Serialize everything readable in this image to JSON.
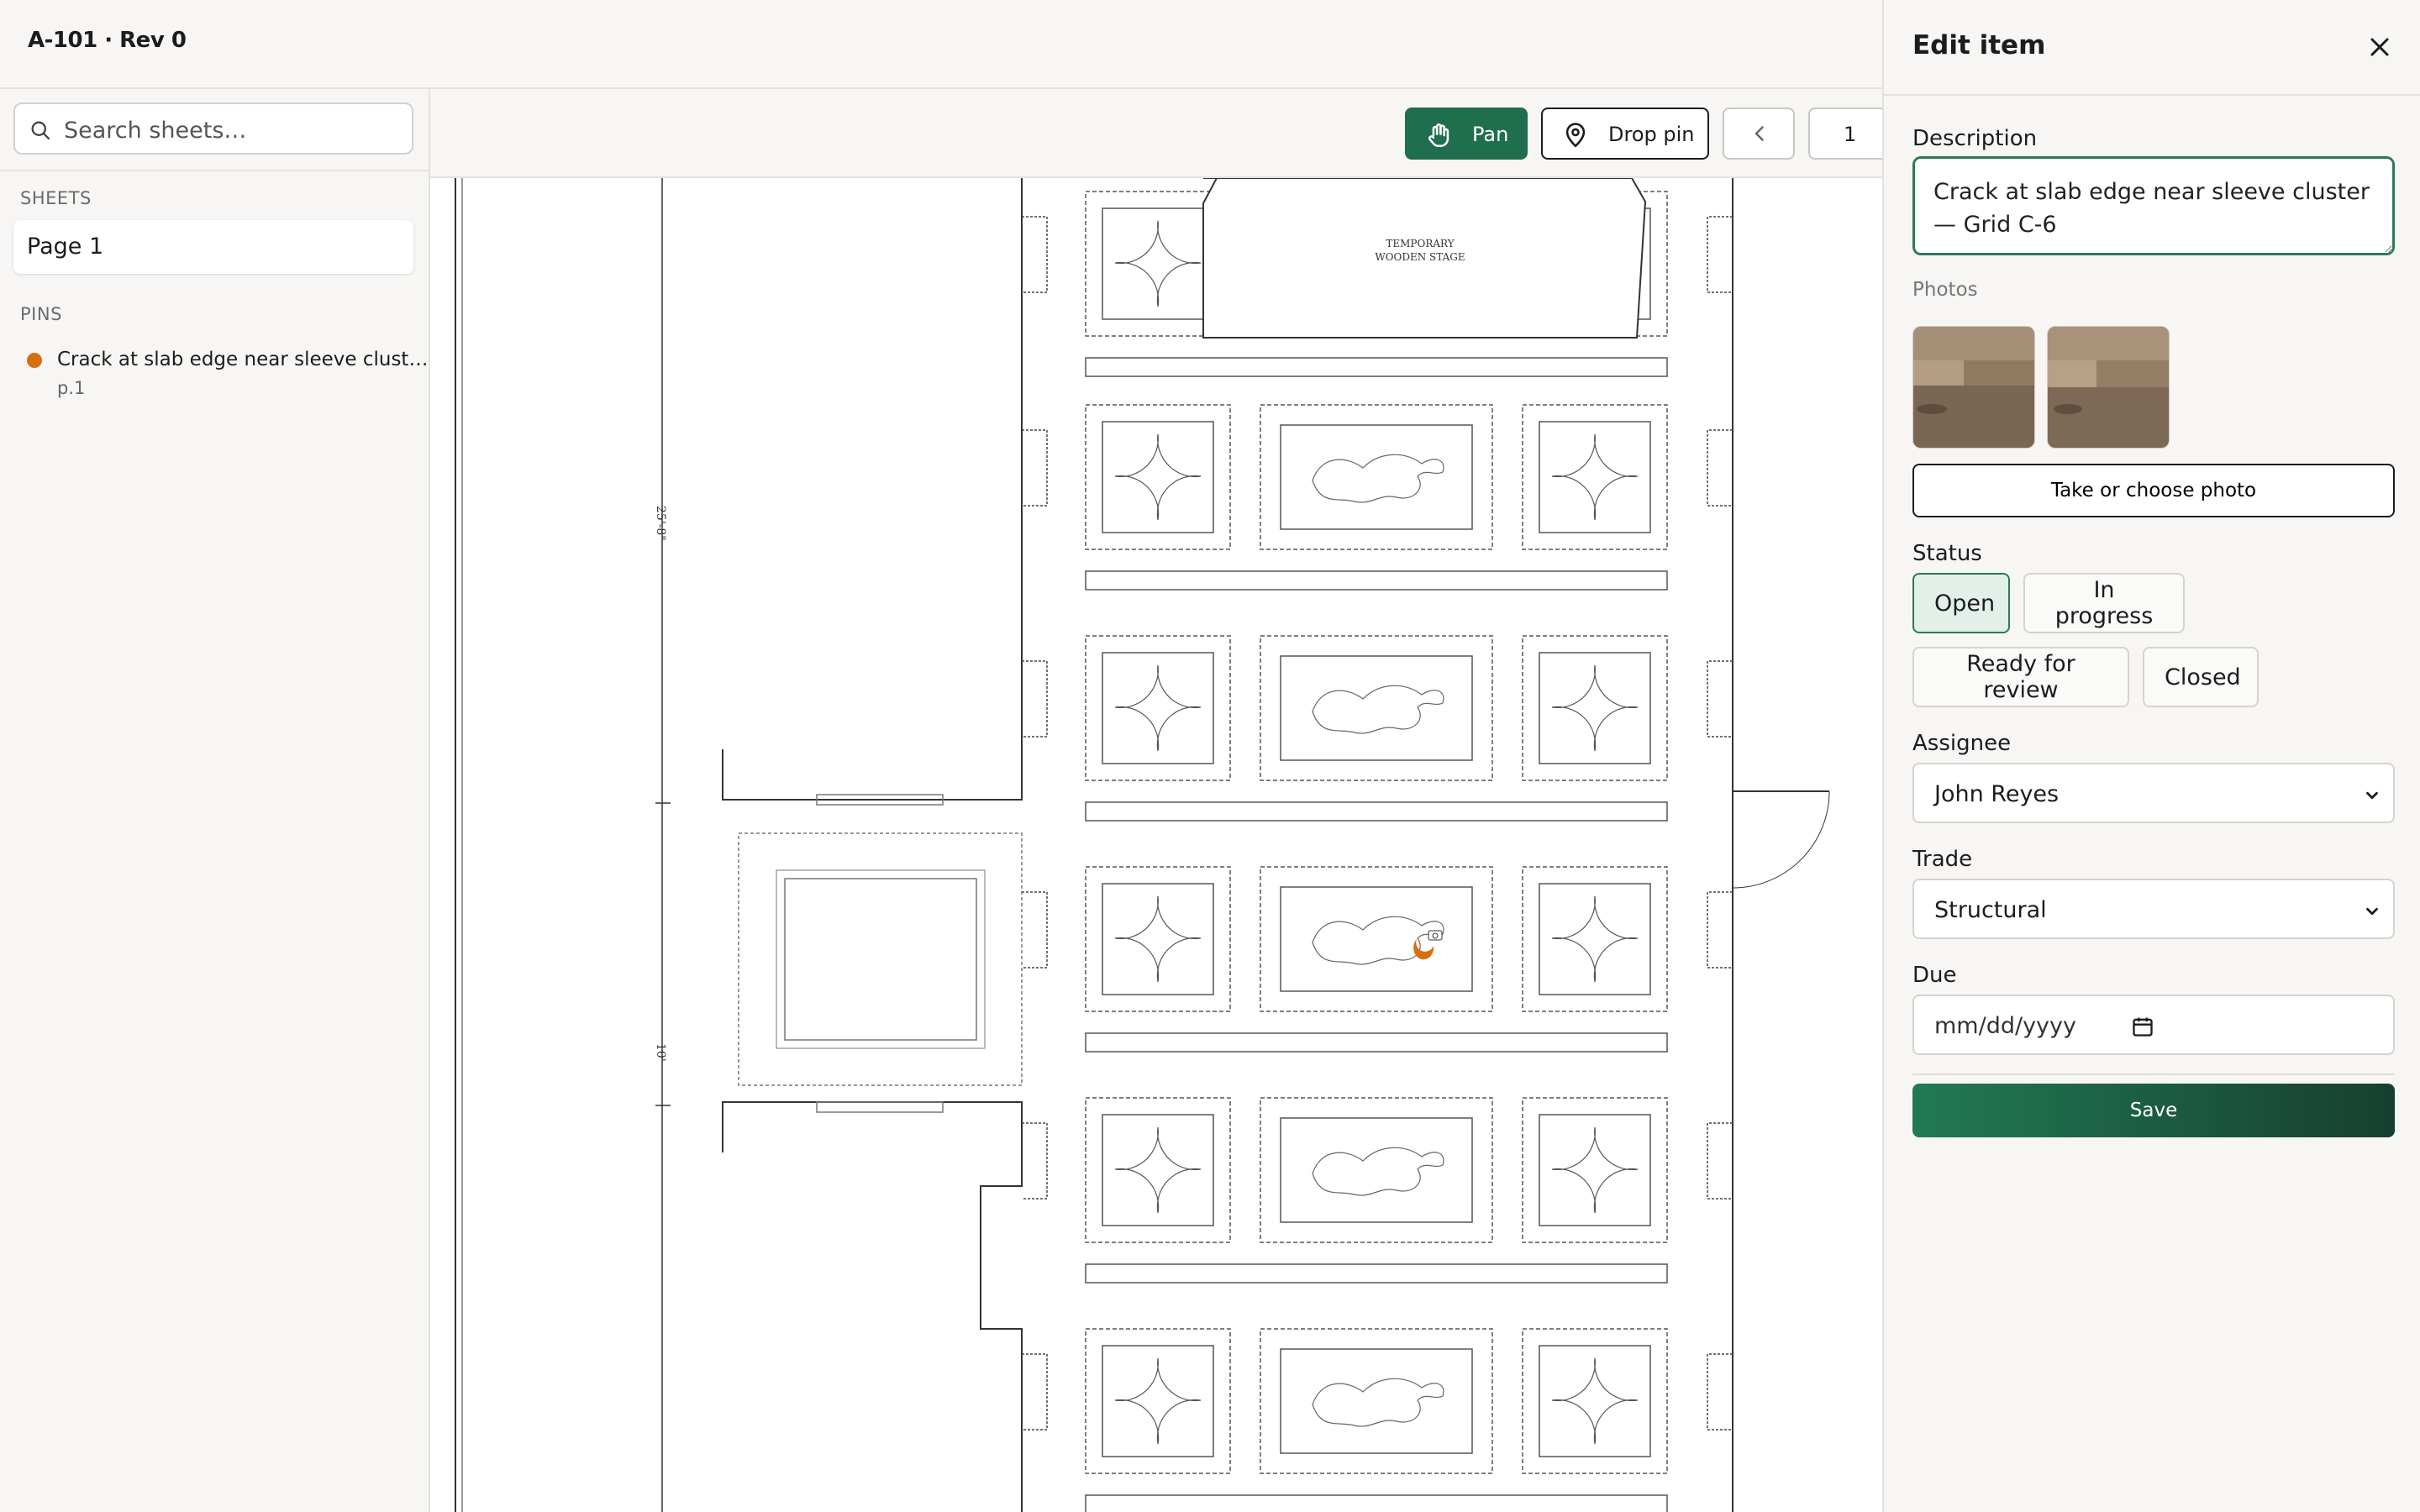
{
  "header": {
    "title": "A-101 · Rev 0"
  },
  "sidebar": {
    "search_placeholder": "Search sheets…",
    "sheets_label": "SHEETS",
    "sheets": [
      {
        "label": "Page 1"
      }
    ],
    "pins_label": "PINS",
    "pins": [
      {
        "title": "Crack at slab edge near sleeve clust…",
        "page": "p.1",
        "color": "#d4700f"
      }
    ]
  },
  "toolbar": {
    "pan_label": "Pan",
    "drop_pin_label": "Drop pin",
    "prev_icon": "chevron-left-icon",
    "page_number": "1"
  },
  "drawing": {
    "stage_label_line1": "TEMPORARY",
    "stage_label_line2": "WOODEN STAGE",
    "dimension_top": "25'-8\"",
    "dimension_mid": "10'",
    "pin_color": "#d4700f"
  },
  "panel": {
    "title": "Edit item",
    "description_label": "Description",
    "description_value": "Crack at slab edge near sleeve cluster — Grid C-6",
    "photos_label": "Photos",
    "photo_button_label": "Take or choose photo",
    "status_label": "Status",
    "status_options": [
      {
        "label": "Open",
        "selected": true
      },
      {
        "label": "In progress",
        "selected": false
      },
      {
        "label": "Ready for review",
        "selected": false
      },
      {
        "label": "Closed",
        "selected": false
      }
    ],
    "assignee_label": "Assignee",
    "assignee_value": "John Reyes",
    "trade_label": "Trade",
    "trade_value": "Structural",
    "due_label": "Due",
    "due_placeholder": "mm/dd/yyyy",
    "save_label": "Save"
  },
  "colors": {
    "accent": "#1f6e4d",
    "pin": "#d4700f",
    "background": "#f7f6f4"
  }
}
